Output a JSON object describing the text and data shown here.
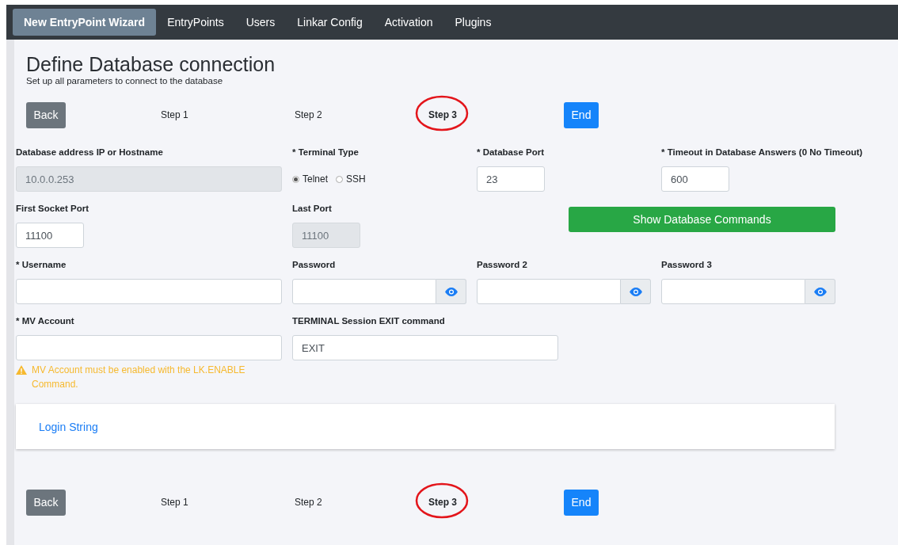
{
  "nav": [
    {
      "label": "New EntryPoint Wizard",
      "selected": true
    },
    {
      "label": "EntryPoints",
      "selected": false
    },
    {
      "label": "Users",
      "selected": false
    },
    {
      "label": "Linkar Config",
      "selected": false
    },
    {
      "label": "Activation",
      "selected": false
    },
    {
      "label": "Plugins",
      "selected": false
    }
  ],
  "title": "Define Database connection",
  "subtitle": "Set up all parameters to connect to the database",
  "stepper_top": {
    "back": "Back",
    "steps": [
      {
        "label": "Step 1",
        "selected": false
      },
      {
        "label": "Step 2",
        "selected": false
      },
      {
        "label": "Step 3",
        "selected": true
      }
    ],
    "end": "End"
  },
  "rows": [
    [
      {
        "kind": "text",
        "label": "Database address IP or Hostname",
        "value": "10.0.0.253",
        "disabled": true
      },
      {
        "kind": "radio",
        "label": "* Terminal Type",
        "options": [
          {
            "label": "Telnet",
            "selected": true
          },
          {
            "label": "SSH",
            "selected": false
          }
        ]
      },
      {
        "kind": "short",
        "label": "* Database Port",
        "value": "23",
        "disabled": false
      },
      {
        "kind": "short",
        "label": "* Timeout in Database Answers (0 No Timeout)",
        "value": "600",
        "disabled": false
      }
    ],
    [
      {
        "kind": "short",
        "label": "First Socket Port",
        "value": "11100",
        "disabled": false
      },
      {
        "kind": "short",
        "label": "Last Port",
        "value": "11100",
        "disabled": true
      },
      {
        "kind": "button",
        "label": "Show Database Commands"
      }
    ],
    [
      {
        "kind": "text",
        "label": "* Username",
        "disabled": false
      },
      {
        "kind": "password",
        "label": "Password"
      },
      {
        "kind": "password",
        "label": "Password 2"
      },
      {
        "kind": "password",
        "label": "Password 3"
      }
    ],
    [
      {
        "kind": "text",
        "label": "* MV Account",
        "disabled": false,
        "warning": "MV Account must be enabled with the LK.ENABLE Command."
      },
      {
        "kind": "text",
        "label": "TERMINAL Session EXIT command",
        "value": "EXIT",
        "disabled": false
      }
    ]
  ],
  "card": {
    "link": "Login String"
  },
  "stepper_bottom": {
    "back": "Back",
    "steps": [
      {
        "label": "Step 1",
        "selected": false
      },
      {
        "label": "Step 2",
        "selected": false
      },
      {
        "label": "Step 3",
        "selected": true
      }
    ],
    "end": "End"
  }
}
